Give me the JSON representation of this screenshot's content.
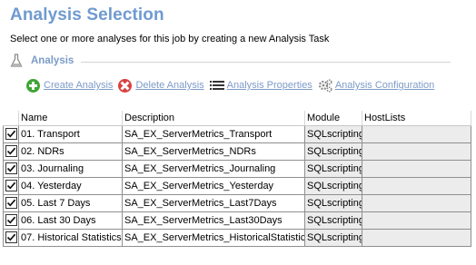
{
  "header": {
    "title": "Analysis Selection",
    "subtitle": "Select one or more analyses for this job by creating a new Analysis Task"
  },
  "section": {
    "label": "Analysis",
    "icon": "flask-icon"
  },
  "toolbar": {
    "create": {
      "label": "Create Analysis",
      "icon": "add-icon",
      "color": "#3fa535"
    },
    "delete": {
      "label": "Delete Analysis",
      "icon": "delete-icon",
      "color": "#d94141"
    },
    "properties": {
      "label": "Analysis Properties",
      "icon": "list-icon"
    },
    "configuration": {
      "label": "Analysis Configuration",
      "icon": "gears-icon"
    }
  },
  "table": {
    "columns": [
      "Name",
      "Description",
      "Module",
      "HostLists"
    ],
    "rows": [
      {
        "checked": true,
        "name": "01. Transport",
        "description": "SA_EX_ServerMetrics_Transport",
        "module": "SQLscripting",
        "hostlists": ""
      },
      {
        "checked": true,
        "name": "02. NDRs",
        "description": "SA_EX_ServerMetrics_NDRs",
        "module": "SQLscripting",
        "hostlists": ""
      },
      {
        "checked": true,
        "name": "03. Journaling",
        "description": "SA_EX_ServerMetrics_Journaling",
        "module": "SQLscripting",
        "hostlists": ""
      },
      {
        "checked": true,
        "name": "04. Yesterday",
        "description": "SA_EX_ServerMetrics_Yesterday",
        "module": "SQLscripting",
        "hostlists": ""
      },
      {
        "checked": true,
        "name": "05. Last 7 Days",
        "description": "SA_EX_ServerMetrics_Last7Days",
        "module": "SQLscripting",
        "hostlists": ""
      },
      {
        "checked": true,
        "name": "06. Last 30 Days",
        "description": "SA_EX_ServerMetrics_Last30Days",
        "module": "SQLscripting",
        "hostlists": ""
      },
      {
        "checked": true,
        "name": "07. Historical Statistics",
        "description": "SA_EX_ServerMetrics_HistoricalStatistics",
        "module": "SQLscripting",
        "hostlists": ""
      }
    ]
  },
  "colors": {
    "title": "#6f9ad0",
    "link": "#7d9bc8",
    "section": "#7a9cc9"
  }
}
